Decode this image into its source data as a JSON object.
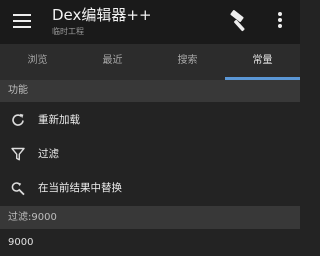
{
  "appbar": {
    "title": "Dex编辑器++",
    "subtitle": "临时工程",
    "menu_icon": "hamburger-menu-icon",
    "hammer_icon": "hammer-icon",
    "more_icon": "more-vert-icon"
  },
  "tabs": [
    {
      "label": "浏览",
      "active": false
    },
    {
      "label": "最近",
      "active": false
    },
    {
      "label": "搜索",
      "active": false
    },
    {
      "label": "常量",
      "active": true
    }
  ],
  "functions": {
    "header": "功能",
    "items": [
      {
        "label": "重新加载",
        "icon": "refresh-icon"
      },
      {
        "label": "过滤",
        "icon": "filter-icon"
      },
      {
        "label": "在当前结果中替换",
        "icon": "find-replace-icon"
      }
    ]
  },
  "filter_section": {
    "header": "过滤:9000",
    "value": "9000"
  },
  "colors": {
    "background": "#232323",
    "appbar": "#1a1a1a",
    "tabbar": "#2c2c2c",
    "section_header": "#383838",
    "accent": "#5b97d6"
  }
}
